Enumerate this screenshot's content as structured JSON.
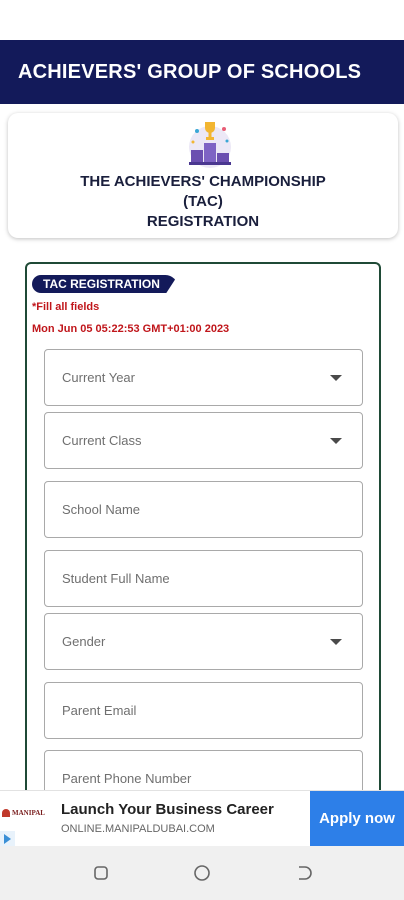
{
  "header": {
    "title": "ACHIEVERS' GROUP OF SCHOOLS"
  },
  "banner": {
    "line1": "THE ACHIEVERS' CHAMPIONSHIP",
    "line2": "(TAC)",
    "line3": "REGISTRATION",
    "icon": "trophy-podium-icon"
  },
  "form": {
    "section_tag": "TAC REGISTRATION",
    "note": "*Fill all fields",
    "timestamp": "Mon Jun 05 05:22:53 GMT+01:00 2023",
    "fields": {
      "current_year": "Current Year",
      "current_class": "Current Class",
      "school_name": "School Name",
      "student_full_name": "Student Full Name",
      "gender": "Gender",
      "parent_email": "Parent Email",
      "parent_phone": "Parent Phone Number"
    }
  },
  "ad": {
    "logo_text": "MANIPAL",
    "headline": "Launch Your Business Career",
    "url": "ONLINE.MANIPALDUBAI.COM",
    "cta": "Apply now"
  },
  "nav": {
    "icons": [
      "recent-apps-icon",
      "home-icon",
      "back-icon"
    ]
  },
  "colors": {
    "header_bg": "#131a5a",
    "error": "#c0161b",
    "cta": "#2d7fe8",
    "card_border": "#1f4a36"
  }
}
